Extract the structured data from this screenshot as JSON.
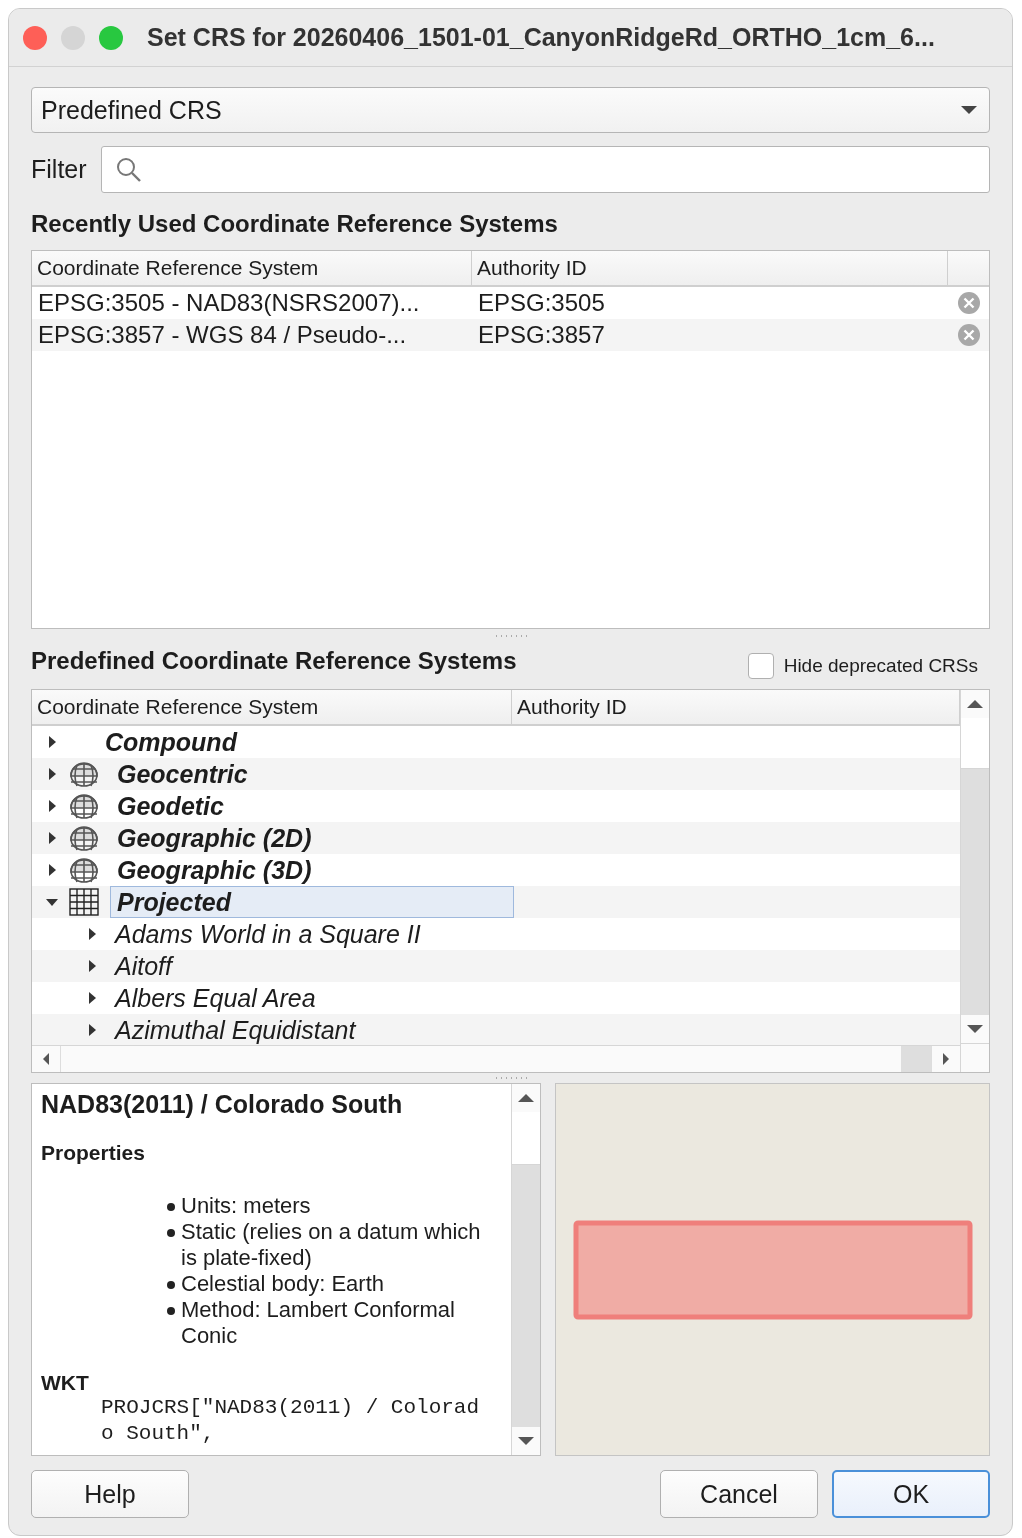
{
  "window": {
    "title": "Set CRS for 20260406_1501-01_CanyonRidgeRd_ORTHO_1cm_6..."
  },
  "crs_type": {
    "value": "Predefined CRS"
  },
  "filter": {
    "label": "Filter"
  },
  "recent": {
    "heading": "Recently Used Coordinate Reference Systems",
    "columns": [
      "Coordinate Reference System",
      "Authority ID"
    ],
    "rows": [
      {
        "name": "EPSG:3505 - NAD83(NSRS2007)...",
        "authority_id": "EPSG:3505"
      },
      {
        "name": "EPSG:3857 - WGS 84 / Pseudo-...",
        "authority_id": "EPSG:3857"
      }
    ]
  },
  "predefined": {
    "heading": "Predefined Coordinate Reference Systems",
    "hide_deprecated": {
      "label": "Hide deprecated CRSs",
      "checked": false
    },
    "columns": [
      "Coordinate Reference System",
      "Authority ID"
    ],
    "tree": [
      {
        "label": "Compound",
        "kind": "plain",
        "expanded": false,
        "selected": false
      },
      {
        "label": "Geocentric",
        "kind": "globe",
        "expanded": false,
        "selected": false
      },
      {
        "label": "Geodetic",
        "kind": "globe",
        "expanded": false,
        "selected": false
      },
      {
        "label": "Geographic (2D)",
        "kind": "globe",
        "expanded": false,
        "selected": false
      },
      {
        "label": "Geographic (3D)",
        "kind": "globe",
        "expanded": false,
        "selected": false
      },
      {
        "label": "Projected",
        "kind": "grid",
        "expanded": true,
        "selected": true,
        "children": [
          {
            "label": "Adams World in a Square II",
            "expanded": false,
            "selected": false
          },
          {
            "label": "Aitoff",
            "expanded": false,
            "selected": false
          },
          {
            "label": "Albers Equal Area",
            "expanded": false,
            "selected": false
          },
          {
            "label": "Azimuthal Equidistant",
            "expanded": false,
            "selected": false
          }
        ]
      }
    ]
  },
  "details": {
    "title": "NAD83(2011) / Colorado South",
    "properties_heading": "Properties",
    "properties": [
      "Units: meters",
      "Static (relies on a datum which is plate-fixed)",
      "Celestial body: Earth",
      "Method: Lambert Conformal Conic"
    ],
    "wkt_heading": "WKT",
    "wkt": "PROJCRS[\"NAD83(2011) / Colorado South\","
  },
  "buttons": [
    {
      "label": "Help",
      "default": false
    },
    {
      "label": "Cancel",
      "default": false
    },
    {
      "label": "OK",
      "default": true
    }
  ]
}
